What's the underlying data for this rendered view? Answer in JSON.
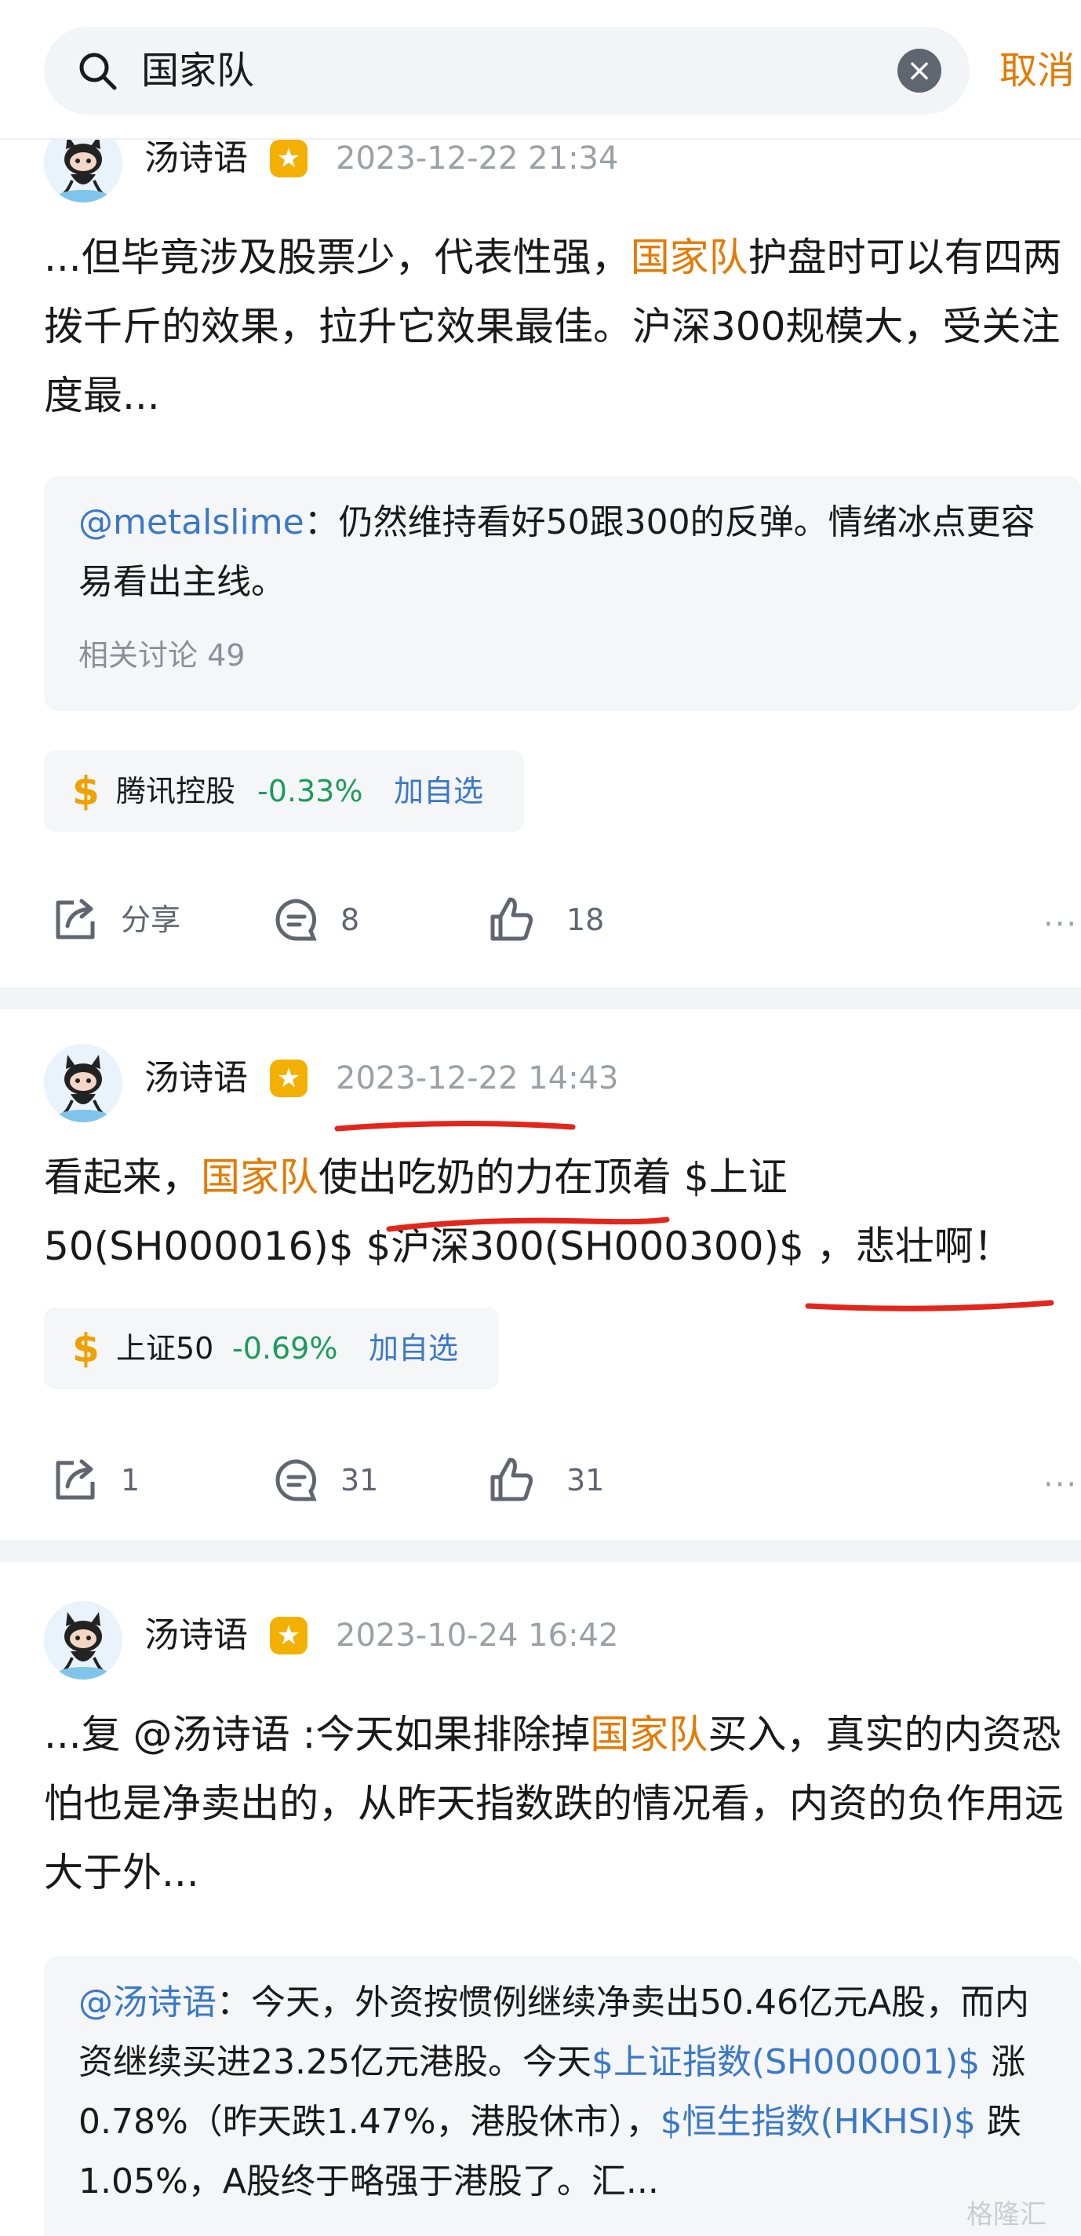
{
  "search": {
    "query": "国家队",
    "cancel_label": "取消"
  },
  "posts": [
    {
      "author": "汤诗语",
      "time": "2023-12-22 21:34",
      "body": [
        {
          "t": "...但毕竟涉及股票少，代表性强，"
        },
        {
          "t": "国家队",
          "hl": true
        },
        {
          "t": "护盘时可以有四两拨千斤的效果，拉升它效果最佳。沪深300规模大，受关注度最..."
        }
      ],
      "quote": {
        "mention": "@metalslime",
        "text": "：仍然维持看好50跟300的反弹。情绪冰点更容易看出主线。",
        "related": "相关讨论 49"
      },
      "stock": {
        "name": "腾讯控股",
        "change": "-0.33%",
        "add": "加自选"
      },
      "actions": {
        "share": "分享",
        "comments": "8",
        "likes": "18"
      }
    },
    {
      "author": "汤诗语",
      "time": "2023-12-22 14:43",
      "body": [
        {
          "t": "看起来，"
        },
        {
          "t": "国家队",
          "hl": true
        },
        {
          "t": "使出吃奶的力在顶着 $上证50(SH000016)$ $沪深300(SH000300)$ ，悲壮啊！"
        }
      ],
      "stock": {
        "name": "上证50",
        "change": "-0.69%",
        "add": "加自选"
      },
      "actions": {
        "share": "1",
        "comments": "31",
        "likes": "31"
      }
    },
    {
      "author": "汤诗语",
      "time": "2023-10-24 16:42",
      "body": [
        {
          "t": "...复 @汤诗语 :今天如果排除掉"
        },
        {
          "t": "国家队",
          "hl": true
        },
        {
          "t": "买入，真实的内资恐怕也是净卖出的，从昨天指数跌的情况看，内资的负作用远大于外..."
        }
      ],
      "quote": {
        "parts": [
          {
            "t": "@汤诗语",
            "link": true
          },
          {
            "t": "：今天，外资按惯例继续净卖出50.46亿元A股，而内资继续买进23.25亿元港股。今天"
          },
          {
            "t": "$上证指数(SH000001)$",
            "link": true
          },
          {
            "t": " 涨0.78%（昨天跌1.47%，港股休市），"
          },
          {
            "t": "$恒生指数(HKHSI)$",
            "link": true
          },
          {
            "t": " 跌1.05%，A股终于略强于港股了。汇..."
          }
        ]
      }
    }
  ],
  "watermark": "格隆汇",
  "colors": {
    "accent": "#e57a00",
    "link": "#3a78c7",
    "down": "#1b9c5a",
    "annotation": "#e3261c"
  }
}
